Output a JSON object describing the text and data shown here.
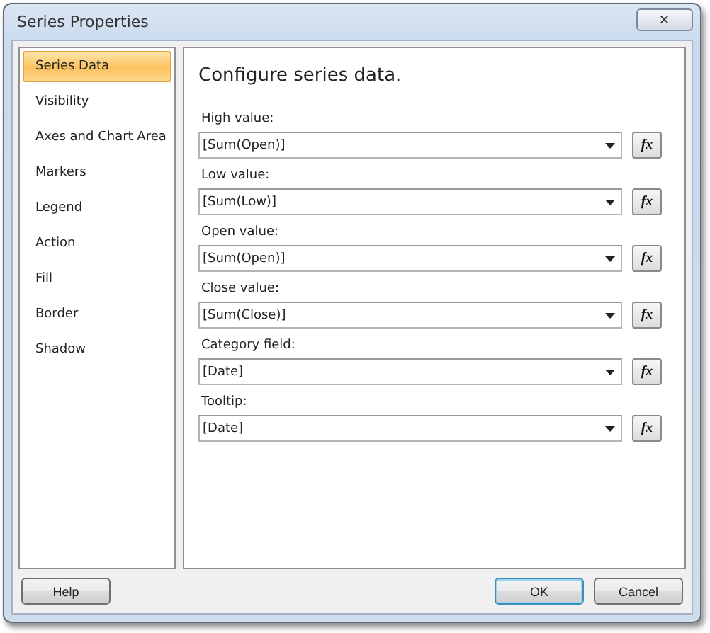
{
  "window": {
    "title": "Series Properties",
    "close": "✕"
  },
  "sidebar": {
    "items": [
      {
        "label": "Series Data",
        "selected": true
      },
      {
        "label": "Visibility",
        "selected": false
      },
      {
        "label": "Axes and Chart Area",
        "selected": false
      },
      {
        "label": "Markers",
        "selected": false
      },
      {
        "label": "Legend",
        "selected": false
      },
      {
        "label": "Action",
        "selected": false
      },
      {
        "label": "Fill",
        "selected": false
      },
      {
        "label": "Border",
        "selected": false
      },
      {
        "label": "Shadow",
        "selected": false
      }
    ]
  },
  "main": {
    "heading": "Configure series data.",
    "fields": [
      {
        "label": "High value:",
        "value": "[Sum(Open)]",
        "expression_button": "fx"
      },
      {
        "label": "Low value:",
        "value": "[Sum(Low)]",
        "expression_button": "fx"
      },
      {
        "label": "Open value:",
        "value": "[Sum(Open)]",
        "expression_button": "fx"
      },
      {
        "label": "Close value:",
        "value": "[Sum(Close)]",
        "expression_button": "fx"
      },
      {
        "label": "Category field:",
        "value": "[Date]",
        "expression_button": "fx"
      },
      {
        "label": "Tooltip:",
        "value": "[Date]",
        "expression_button": "fx"
      }
    ]
  },
  "buttons": {
    "help": "Help",
    "ok": "OK",
    "cancel": "Cancel"
  }
}
